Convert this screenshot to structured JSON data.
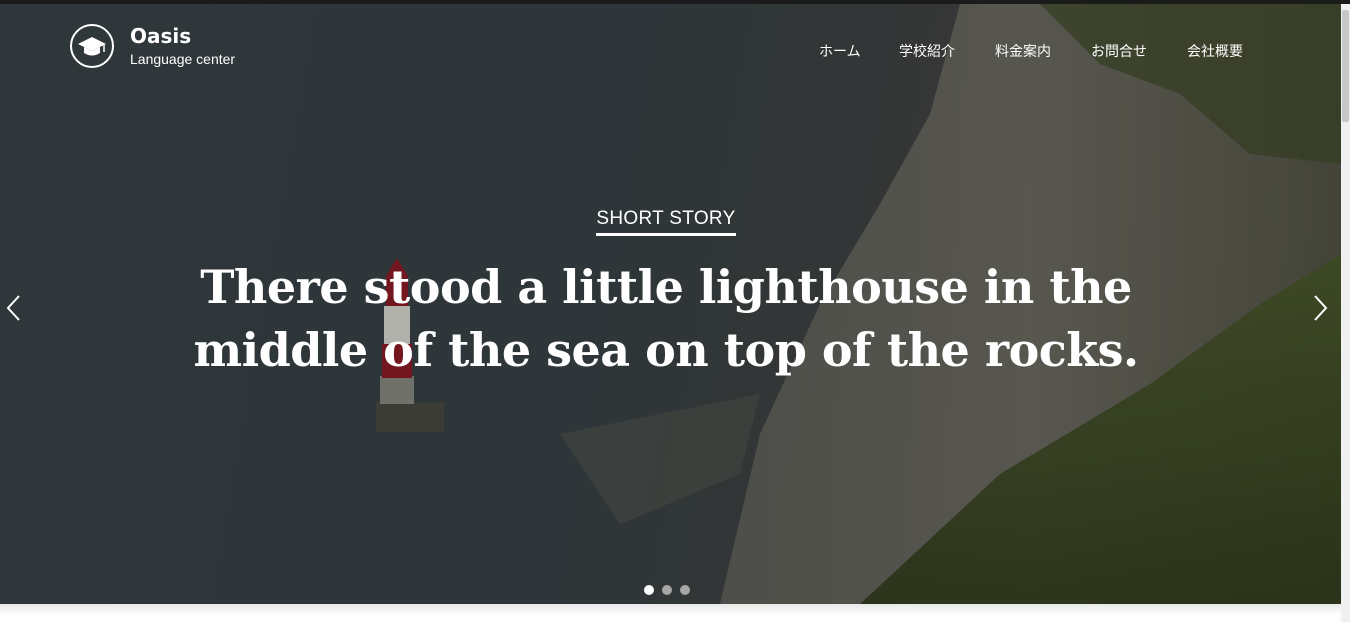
{
  "brand": {
    "name": "Oasis",
    "subtitle": "Language center",
    "logo_icon": "graduation-cap-icon"
  },
  "nav": {
    "items": [
      {
        "label": "ホーム"
      },
      {
        "label": "学校紹介"
      },
      {
        "label": "料金案内"
      },
      {
        "label": "お問合せ"
      },
      {
        "label": "会社概要"
      }
    ]
  },
  "hero": {
    "kicker": "SHORT STORY",
    "headline": "There stood a little lighthouse in the middle of the sea on top of the rocks.",
    "prev_icon": "chevron-left-icon",
    "next_icon": "chevron-right-icon",
    "slide_count": 3,
    "active_slide": 1
  },
  "colors": {
    "text": "#ffffff",
    "dot_inactive": "#a8a8a8",
    "dot_active": "#ffffff"
  }
}
